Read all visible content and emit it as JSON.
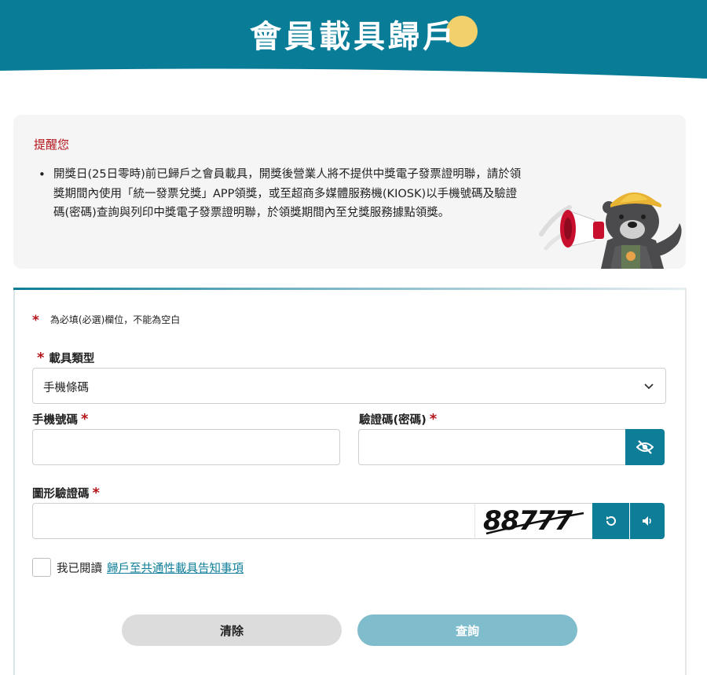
{
  "header": {
    "title": "會員載具歸戶",
    "bg_color": "#097c97",
    "accent_color": "#f2d06b"
  },
  "notice": {
    "title": "提醒您",
    "items": [
      "開獎日(25日零時)前已歸戶之會員載具，開獎後營業人將不提供中獎電子發票證明聯，請於領獎期間內使用「統一發票兌獎」APP領獎，或至超商多媒體服務機(KIOSK)以手機號碼及驗證碼(密碼)查詢與列印中獎電子發票證明聯，於領獎期間內至兌獎服務據點領獎。"
    ]
  },
  "form": {
    "required_star": "*",
    "required_note": "為必填(必選)欄位，不能為空白",
    "carrier_type": {
      "label": "載具類型",
      "selected": "手機條碼"
    },
    "phone": {
      "label": "手機號碼",
      "value": ""
    },
    "verify_code": {
      "label": "驗證碼(密碼)",
      "value": ""
    },
    "captcha": {
      "label": "圖形驗證碼",
      "value": "",
      "image_text": "88777"
    },
    "agree": {
      "text": "我已閱讀",
      "link": "歸戶至共通性載具告知事項"
    },
    "buttons": {
      "clear": "清除",
      "query": "查詢"
    }
  },
  "colors": {
    "primary": "#0d7d98",
    "required": "#b4151b",
    "query_btn": "#7fbccc",
    "clear_btn": "#dcdcdc"
  }
}
